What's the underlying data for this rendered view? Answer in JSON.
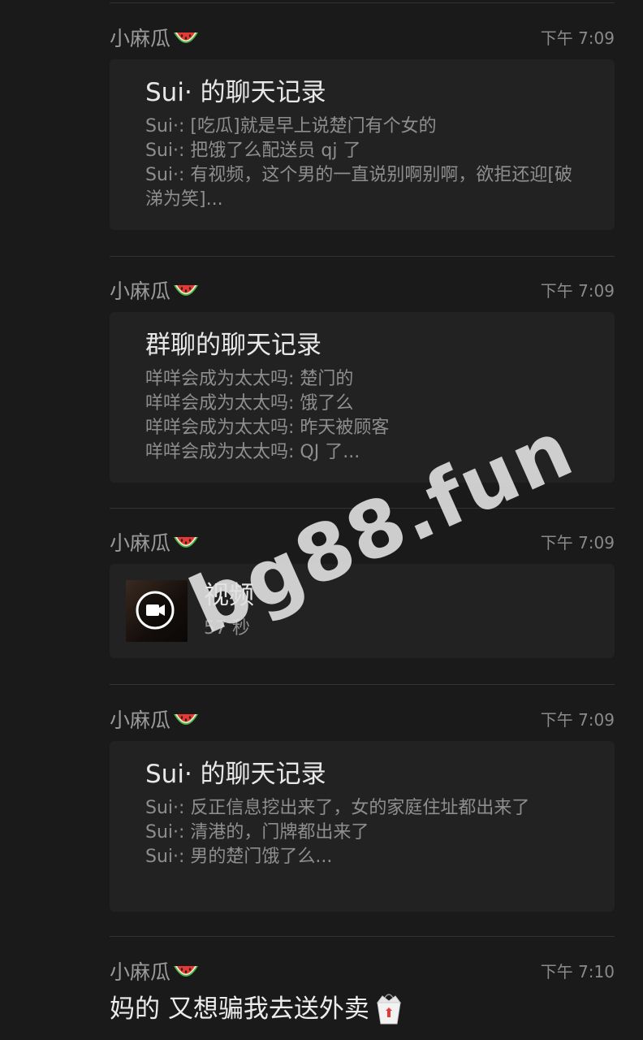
{
  "messages": [
    {
      "sender": "小麻瓜",
      "time": "下午 7:09",
      "type": "chat_record",
      "title": "Sui· 的聊天记录",
      "lines": [
        "Sui·: [吃瓜]就是早上说楚门有个女的",
        "Sui·: 把饿了么配送员 qj 了",
        "Sui·: 有视频，这个男的一直说别啊别啊，欲拒还迎[破涕为笑]..."
      ]
    },
    {
      "sender": "小麻瓜",
      "time": "下午 7:09",
      "type": "chat_record",
      "title": "群聊的聊天记录",
      "lines": [
        "咩咩会成为太太吗: 楚门的",
        "咩咩会成为太太吗: 饿了么",
        "咩咩会成为太太吗: 昨天被顾客",
        "咩咩会成为太太吗: QJ 了..."
      ]
    },
    {
      "sender": "小麻瓜",
      "time": "下午 7:09",
      "type": "video",
      "title": "视频",
      "duration": "57 秒"
    },
    {
      "sender": "小麻瓜",
      "time": "下午 7:09",
      "type": "chat_record",
      "title": "Sui· 的聊天记录",
      "lines": [
        "Sui·: 反正信息挖出来了，女的家庭住址都出来了",
        "Sui·: 清港的，门牌都出来了",
        "Sui·: 男的楚门饿了么..."
      ]
    },
    {
      "sender": "小麻瓜",
      "time": "下午 7:10",
      "type": "text",
      "text": "妈的 又想骗我去送外卖"
    }
  ],
  "icons": {
    "sender_emoji": "watermelon-icon",
    "video_play": "video-camera-icon",
    "text_emoji": "takeout-box-icon"
  },
  "watermark": "bg88.fun"
}
